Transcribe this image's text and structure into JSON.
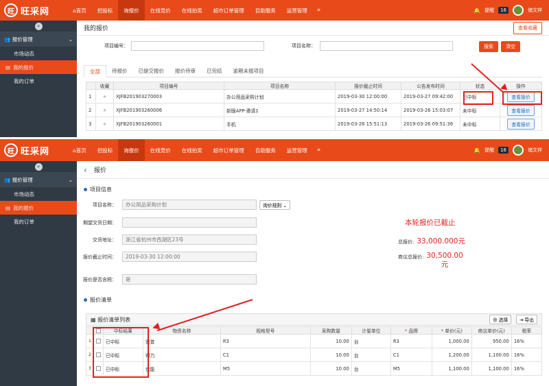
{
  "brand": {
    "mark": "旺",
    "name": "旺采网"
  },
  "nav": {
    "items": [
      "首页",
      "招投标",
      "询报价",
      "在线竞价",
      "在线拍卖",
      "超市订单管理",
      "自助服务",
      "运营管理"
    ],
    "more": "»"
  },
  "user": {
    "remind_label": "提醒",
    "remind_count": "16",
    "name": "储文祥"
  },
  "sidebar": {
    "group": "报价管理",
    "items": [
      "市场动态",
      "我的报价",
      "我的订单"
    ]
  },
  "panel1": {
    "title": "我的报价",
    "view_fav": "查看收藏",
    "search": {
      "code_label": "项目编号：",
      "name_label": "项目名称：",
      "search_btn": "搜索",
      "clear_btn": "清空"
    },
    "tabs": [
      "全部",
      "待报价",
      "已提交报价",
      "报价待审",
      "已完结",
      "逾期未报项目"
    ],
    "table": {
      "headers": [
        "",
        "收藏",
        "项目编号",
        "项目名称",
        "报价截止时间",
        "公告发布时间",
        "状态",
        "操作"
      ],
      "rows": [
        {
          "no": "1",
          "code": "XJFB201903270003",
          "name": "办公用品采购计划",
          "deadline": "2019-03-30 12:00:00",
          "publish": "2019-03-27 09:42:00",
          "status": "已中标",
          "action": "查看报价"
        },
        {
          "no": "2",
          "code": "XJFB201903260006",
          "name": "新版APP-邀请1",
          "deadline": "2019-03-27 14:50:14",
          "publish": "2019-03-26 15:03:07",
          "status": "未中标",
          "action": "查看报价"
        },
        {
          "no": "3",
          "code": "XJFB201903260001",
          "name": "手机",
          "deadline": "2019-03-26 15:51:13",
          "publish": "2019-03-26 09:51:36",
          "status": "未中标",
          "action": "查看报价"
        }
      ]
    }
  },
  "panel2": {
    "title": "报价",
    "back": "‹",
    "info_section": "项目信息",
    "form": [
      {
        "label": "项目名称：",
        "value": "办公用品采购计划"
      },
      {
        "label": "期望交货日期：",
        "value": ""
      },
      {
        "label": "交货地址：",
        "value": "浙江省杭州市西湖区23号"
      },
      {
        "label": "报价截止时间：",
        "value": "2019-03-30 12:00:00"
      },
      {
        "label": "报价是否含税：",
        "value": "是"
      }
    ],
    "rule_btn": "询价规则",
    "closed_notice": "本轮报价已截止",
    "total_label": "总报价:",
    "total_value": "33,000.000元",
    "agreed_label": "商议总报价:",
    "agreed_value": "30,500.00",
    "agreed_unit": "元",
    "list_section": "报价清单",
    "grid_title": "报价清单列表",
    "select_btn": "选择",
    "export_btn": "导出",
    "grid": {
      "headers": [
        "",
        "中标结果",
        "物资名称",
        "规格型号",
        "采购数量",
        "计量单位",
        "品牌",
        "单价(元)",
        "商议单价(元)",
        "税率"
      ],
      "rows": [
        {
          "result": "已中标",
          "material": "塞普",
          "spec": "R3",
          "qty": "10.00",
          "unit": "台",
          "brand": "R3",
          "price": "1,000.00",
          "agreed": "950.00",
          "tax": "16%"
        },
        {
          "result": "已中标",
          "material": "得力",
          "spec": "C1",
          "qty": "10.00",
          "unit": "台",
          "brand": "C1",
          "price": "1,200.00",
          "agreed": "1,100.00",
          "tax": "16%"
        },
        {
          "result": "已中标",
          "material": "佳能",
          "spec": "M5",
          "qty": "10.00",
          "unit": "台",
          "brand": "M5",
          "price": "1,100.00",
          "agreed": "1,100.00",
          "tax": "16%"
        }
      ]
    }
  }
}
